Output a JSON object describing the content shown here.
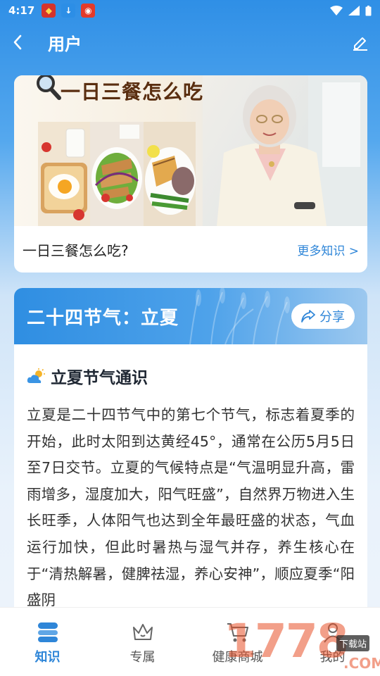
{
  "status_bar": {
    "time": "4:17"
  },
  "header": {
    "title": "用户"
  },
  "knowledge_card": {
    "banner_title": "一日三餐怎么吃?",
    "caption": "一日三餐怎么吃?",
    "more_link": "更多知识 >"
  },
  "term_card": {
    "title": "二十四节气：立夏",
    "share_label": "分享",
    "section_title": "立夏节气通识",
    "text": "立夏是二十四节气中的第七个节气，标志着夏季的开始，此时太阳到达黄经45°，通常在公历5月5日至7日交节。立夏的气候特点是“气温明显升高，雷雨增多，湿度加大，阳气旺盛”，自然界万物进入生长旺季，人体阳气也达到全年最旺盛的状态，气血运行加快，但此时暑热与湿气并存，养生核心在于“清热解暑，健脾祛湿，养心安神”，顺应夏季“阳盛阴"
  },
  "bottom_nav": [
    {
      "label": "知识",
      "icon": "knowledge-icon",
      "active": true
    },
    {
      "label": "专属",
      "icon": "crown-icon",
      "active": false
    },
    {
      "label": "健康商城",
      "icon": "cart-icon",
      "active": false
    },
    {
      "label": "我的",
      "icon": "profile-icon",
      "active": false
    }
  ],
  "watermark": {
    "text": "1778",
    "badge": "下载站",
    "suffix": ".COM"
  },
  "colors": {
    "accent": "#2f86d8",
    "header_blue": "#2f8fe6"
  }
}
